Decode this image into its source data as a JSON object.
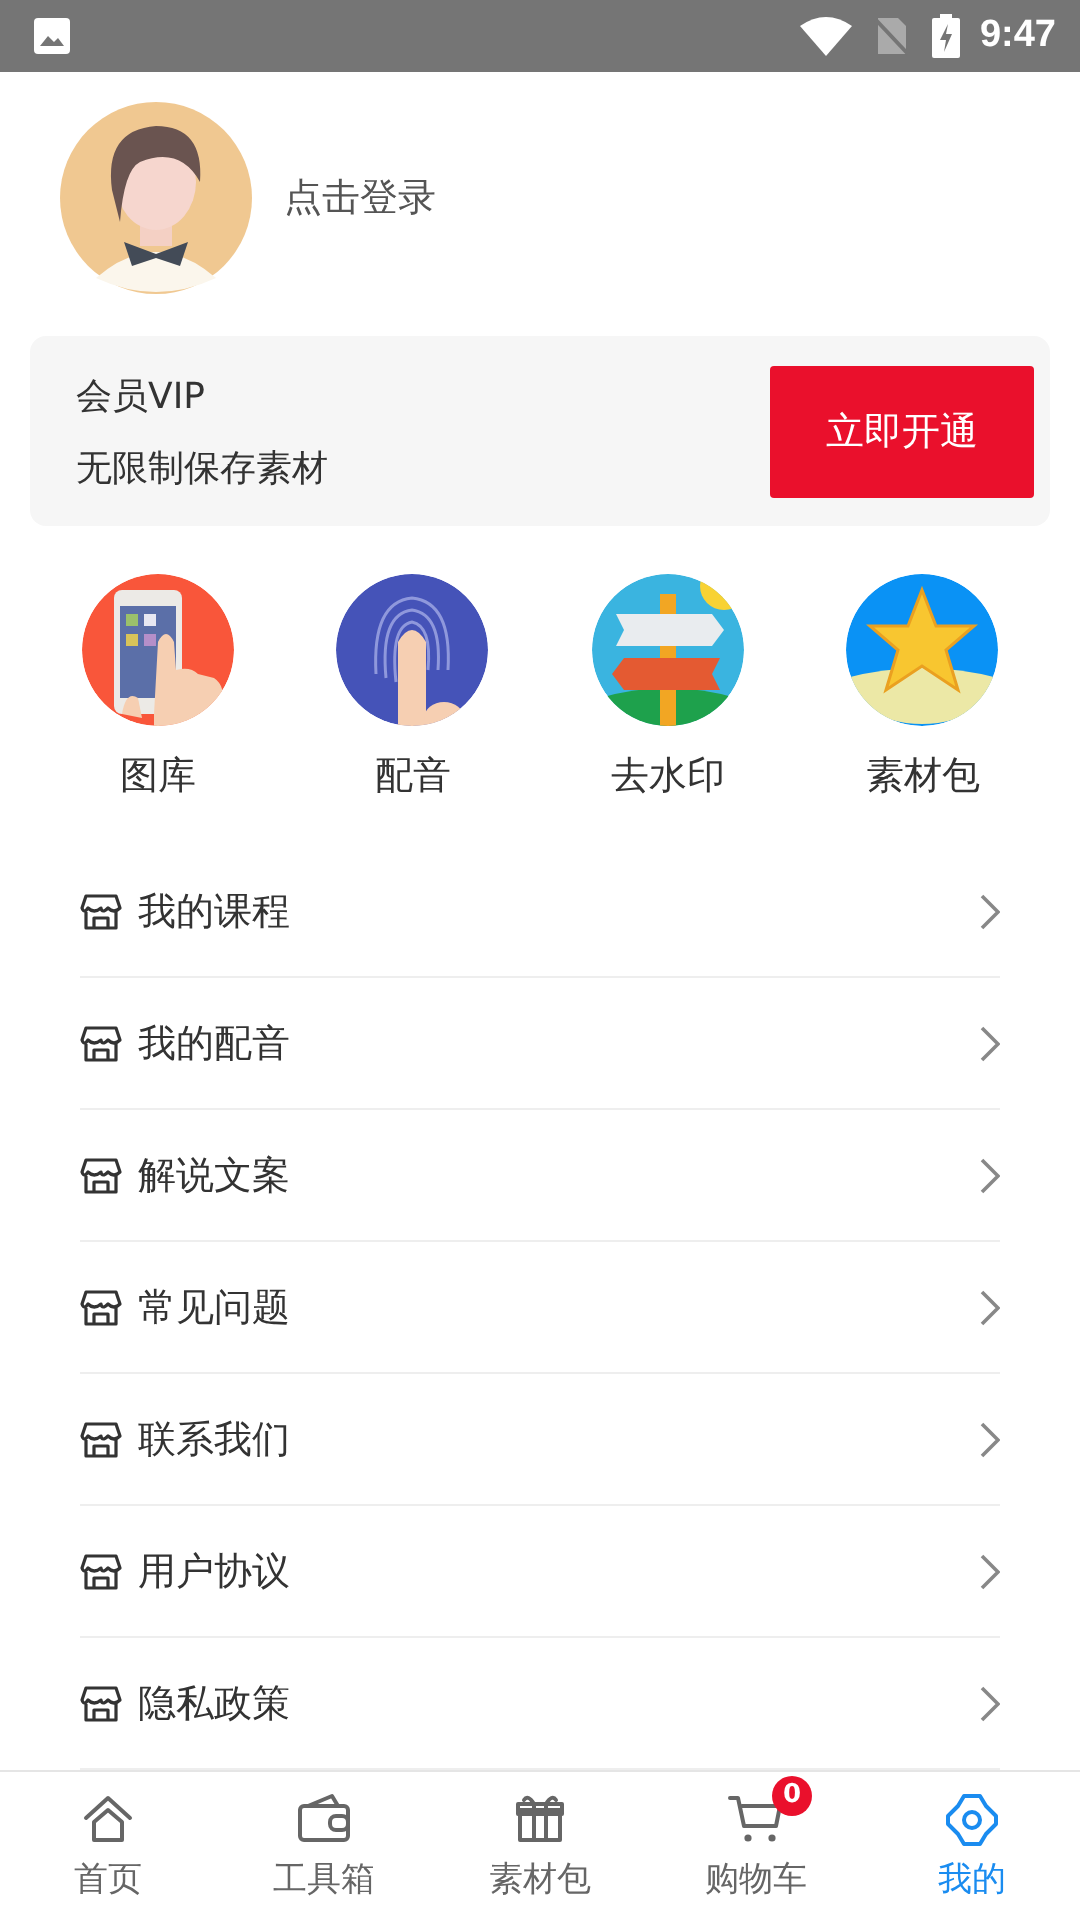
{
  "status_bar": {
    "time": "9:47"
  },
  "profile": {
    "login_label": "点击登录"
  },
  "vip_card": {
    "title": "会员VIP",
    "subtitle": "无限制保存素材",
    "button": "立即开通"
  },
  "shortcuts": [
    {
      "kind": "gallery",
      "label": "图库"
    },
    {
      "kind": "dubbing",
      "label": "配音"
    },
    {
      "kind": "watermark",
      "label": "去水印"
    },
    {
      "kind": "materials",
      "label": "素材包"
    }
  ],
  "menu": [
    "我的课程",
    "我的配音",
    "解说文案",
    "常见问题",
    "联系我们",
    "用户协议",
    "隐私政策"
  ],
  "bottom_nav": [
    {
      "kind": "home",
      "label": "首页",
      "selected": false
    },
    {
      "kind": "toolbox",
      "label": "工具箱",
      "selected": false
    },
    {
      "kind": "gift",
      "label": "素材包",
      "selected": false
    },
    {
      "kind": "cart",
      "label": "购物车",
      "selected": false,
      "badge": "0"
    },
    {
      "kind": "settings",
      "label": "我的",
      "selected": true
    }
  ]
}
